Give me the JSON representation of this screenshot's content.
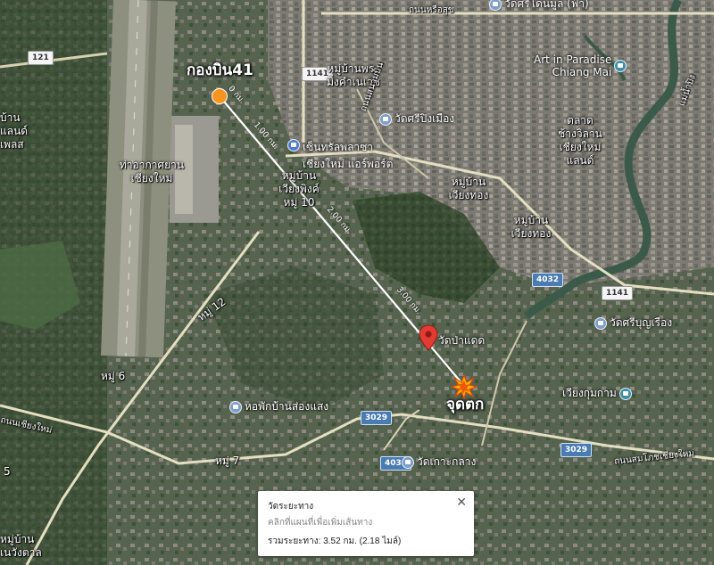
{
  "map": {
    "places": {
      "wing41": "กองบิน41",
      "airport_line1": "ท่าอากาศยาน",
      "airport_line2": "เชียงใหม่",
      "crash_site": "จุดตก",
      "moo_ban_phra_mingkhwan_1": "หมู่บ้านพระ",
      "moo_ban_phra_mingkhwan_2": "มิ่งคำเนเวช",
      "wiang_phing_1": "หมู่บ้าน",
      "wiang_phing_2": "เวียงพิงค์",
      "moo10": "หมู่ 10",
      "wiang_thong_1": "หมู่บ้าน",
      "wiang_thong_2": "เวียงทอง",
      "wiang_thong_b1": "หมู่บ้าน",
      "wiang_thong_b2": "เวียงทอง",
      "moo12": "หมู่ 12",
      "moo6": "หมู่ 6",
      "moo7": "หมู่ 7",
      "ban_lan_1": "บ้าน",
      "ban_lan_2": "แลนด์",
      "ban_lan_3": "เพลส",
      "chiang_mai_land_1": "ตลาด",
      "chiang_mai_land_2": "ช้างวิลาน",
      "chiang_mai_land_3": "เชียงใหม่",
      "chiang_mai_land_4": "แลนด์",
      "moo_ban_wang_1": "หมู่บ้าน",
      "moo_ban_wang_2": "เนวังตาล",
      "num5": "5",
      "road_top": "ถนนหรือสุข",
      "road_right": "แม่น้ำปิง",
      "road_airport": "ถนนสนามบิน",
      "road_left": "ถนนเชียงใหม่",
      "road_bottom": "ถนนสมโภชเชียงใหม่"
    },
    "pois": {
      "art_paradise_1": "Art in Paradise",
      "art_paradise_2": "Chiang Mai",
      "wat_sri_ping_mueang": "วัดศรีปิงเมือง",
      "central_1": "เซ็นทรัลพลาซา",
      "central_2": "เชียงใหม่ แอร์พอร์ต",
      "wat_pa_daet": "วัดป่าแดด",
      "wat_sri_bunrueang": "วัดศรีบุญเรือง",
      "wiang_kum_kam": "เวียงกุมกาม",
      "hostel": "หอพักบ้านส่องแสง",
      "wat_ko_klang": "วัดเกาะกลาง",
      "wat_top": "วัดศรีโดนมูล (ฟ้า)"
    },
    "shields": {
      "r121": "121",
      "r1141_top": "1141",
      "r1141_right": "1141",
      "r4032_right": "4032",
      "r4032_bottom": "4032",
      "r3029_mid": "3029",
      "r3029_right": "3029"
    },
    "distances": {
      "d1": "1.00 กม.",
      "d2": "2.00 กม.",
      "d3": "3.00 กม.",
      "d0": "0 กม."
    },
    "colors": {
      "wing_marker": "#f7941d",
      "pin": "#e23b31",
      "measure_line": "#ffffff",
      "explosion": "#ffb300"
    },
    "icons": {
      "wing_marker": "circle-marker",
      "pin": "map-pin-icon",
      "crash": "explosion-icon",
      "close": "close-icon"
    }
  },
  "panel": {
    "title": "วัดระยะทาง",
    "hint": "คลิกที่แผนที่เพื่อเพิ่มเส้นทาง",
    "total": "รวมระยะทาง: 3.52 กม. (2.18 ไมล์)",
    "close": "✕"
  }
}
